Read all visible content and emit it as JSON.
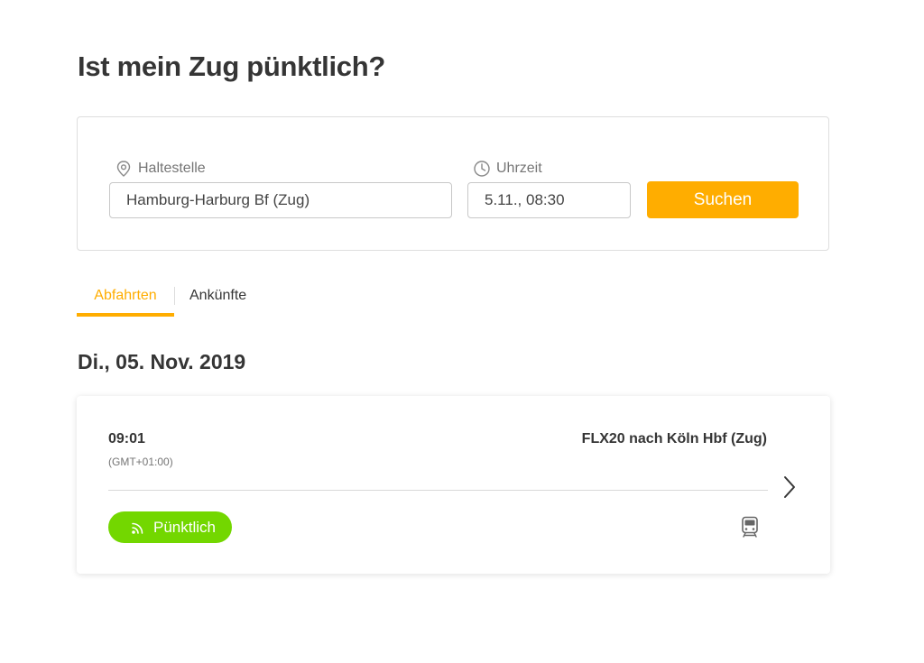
{
  "page": {
    "title": "Ist mein Zug pünktlich?"
  },
  "search": {
    "stop_label": "Haltestelle",
    "stop_value": "Hamburg-Harburg Bf (Zug)",
    "time_label": "Uhrzeit",
    "time_value": "5.11., 08:30",
    "button_label": "Suchen",
    "stop_icon": "location-pin-icon",
    "time_icon": "clock-icon"
  },
  "tabs": [
    {
      "label": "Abfahrten",
      "active": true
    },
    {
      "label": "Ankünfte",
      "active": false
    }
  ],
  "date_heading": "Di., 05. Nov. 2019",
  "departures": [
    {
      "time": "09:01",
      "timezone": "(GMT+01:00)",
      "train": "FLX20 nach Köln Hbf (Zug)",
      "status": "Pünktlich",
      "status_icon": "live-signal-icon",
      "vehicle_icon": "train-icon"
    }
  ],
  "colors": {
    "accent": "#ffad00",
    "status_green": "#73d700",
    "text": "#353535"
  }
}
